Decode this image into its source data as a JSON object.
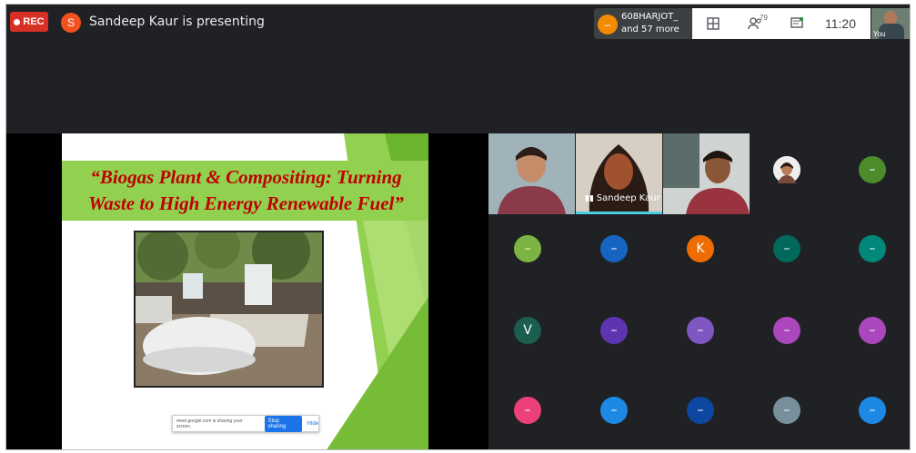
{
  "recording": {
    "label": "REC"
  },
  "presenter": {
    "initial": "S",
    "text": "Sandeep Kaur is presenting",
    "color": "#f4511e"
  },
  "participants": {
    "name": "608HARJOT_",
    "more": "and 57 more",
    "count": "79",
    "avatar_color": "#f28b00"
  },
  "clock": "11:20",
  "self_view": {
    "label": "You"
  },
  "slide": {
    "title_line1": "“Biogas Plant & Compositing: Turning",
    "title_line2": "Waste to High Energy Renewable Fuel”",
    "title_bg": "#92d050",
    "title_color": "#c00000"
  },
  "share_notice": {
    "text": "meet.google.com is sharing your screen.",
    "stop_label": "Stop sharing",
    "hide_label": "Hide"
  },
  "speaker": {
    "name": "Sandeep Kaur"
  },
  "grid_tiles": [
    {
      "initial": "",
      "kind": "photo",
      "color": "#e0c9b5"
    },
    {
      "initial": "–",
      "color": "#4c8c2b"
    },
    {
      "initial": "–",
      "color": "#7cb342"
    },
    {
      "initial": "–",
      "color": "#1565c0"
    },
    {
      "initial": "K",
      "color": "#ef6c00"
    },
    {
      "initial": "–",
      "color": "#00695c"
    },
    {
      "initial": "–",
      "color": "#00897b"
    },
    {
      "initial": "V",
      "color": "#1b5e50"
    },
    {
      "initial": "–",
      "color": "#5e35b1"
    },
    {
      "initial": "–",
      "color": "#7e57c2"
    },
    {
      "initial": "–",
      "color": "#ab47bc"
    },
    {
      "initial": "–",
      "color": "#ab47bc"
    },
    {
      "initial": "–",
      "color": "#ec407a"
    },
    {
      "initial": "–",
      "color": "#1e88e5"
    },
    {
      "initial": "–",
      "color": "#0d47a1"
    },
    {
      "initial": "–",
      "color": "#78909c"
    },
    {
      "initial": "–",
      "color": "#1e88e5"
    }
  ]
}
